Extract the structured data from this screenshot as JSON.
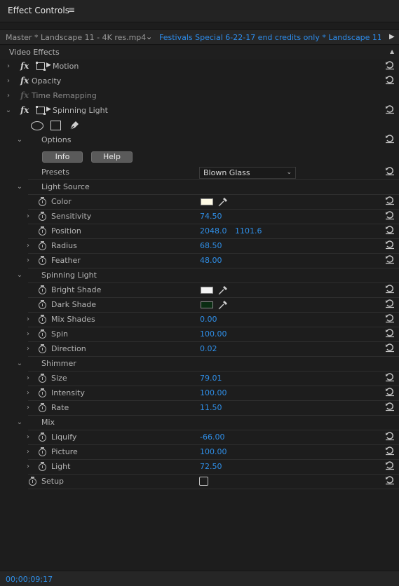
{
  "panel": {
    "title": "Effect Controls",
    "menu_glyph": "≡"
  },
  "clipbar": {
    "master": "Master * Landscape 11 - 4K res.mp4",
    "chevron": "⌄",
    "sequence": "Festivals Special 6-22-17 end credits only * Landscape 11 -...",
    "play": "▶"
  },
  "video_effects": {
    "label": "Video Effects",
    "scroll_up": "▲"
  },
  "glyphs": {
    "collapsed": "›",
    "expanded": "⌄",
    "fx": "fx",
    "mask_arrow": "▶",
    "dropdown_chevron": "⌄"
  },
  "effects": {
    "motion": "Motion",
    "opacity": "Opacity",
    "time_remapping": "Time Remapping",
    "spinning_light": "Spinning Light"
  },
  "options": {
    "label": "Options",
    "info_button": "Info",
    "help_button": "Help",
    "presets_label": "Presets",
    "presets_value": "Blown Glass"
  },
  "light_source": {
    "label": "Light Source",
    "color": {
      "label": "Color",
      "swatch": "#fffbe6"
    },
    "sensitivity": {
      "label": "Sensitivity",
      "value": "74.50"
    },
    "position": {
      "label": "Position",
      "x": "2048.0",
      "y": "1101.6"
    },
    "radius": {
      "label": "Radius",
      "value": "68.50"
    },
    "feather": {
      "label": "Feather",
      "value": "48.00"
    }
  },
  "spinning_group": {
    "label": "Spinning Light",
    "bright_shade": {
      "label": "Bright Shade",
      "swatch": "#f4f4f4"
    },
    "dark_shade": {
      "label": "Dark Shade",
      "swatch": "#0a2c12"
    },
    "mix_shades": {
      "label": "Mix Shades",
      "value": "0.00"
    },
    "spin": {
      "label": "Spin",
      "value": "100.00"
    },
    "direction": {
      "label": "Direction",
      "value": "0.02"
    }
  },
  "shimmer": {
    "label": "Shimmer",
    "size": {
      "label": "Size",
      "value": "79.01"
    },
    "intensity": {
      "label": "Intensity",
      "value": "100.00"
    },
    "rate": {
      "label": "Rate",
      "value": "11.50"
    }
  },
  "mix": {
    "label": "Mix",
    "liquify": {
      "label": "Liquify",
      "value": "-66.00"
    },
    "picture": {
      "label": "Picture",
      "value": "100.00"
    },
    "light": {
      "label": "Light",
      "value": "72.50"
    }
  },
  "setup": {
    "label": "Setup"
  },
  "footer": {
    "timecode": "00;00;09;17"
  },
  "colors": {
    "accent_value": "#2f8fe8",
    "sequence_link": "#2d8ceb",
    "background": "#1d1d1d"
  }
}
